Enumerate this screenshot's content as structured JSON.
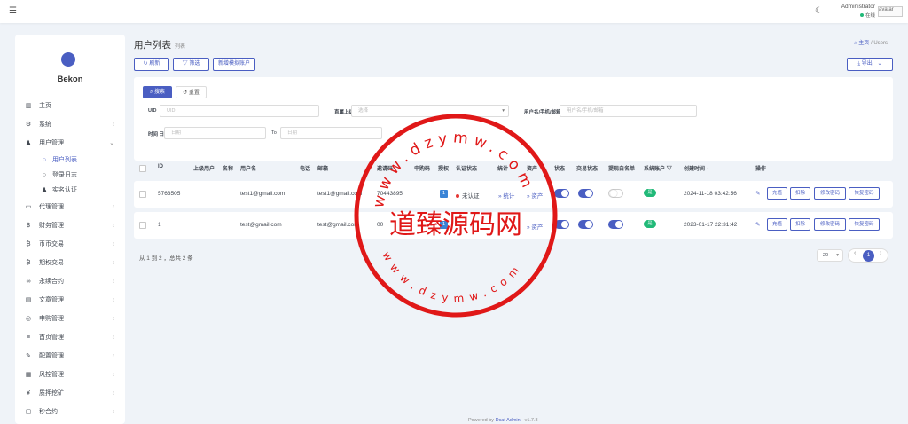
{
  "topbar": {
    "admin_name": "Administrator",
    "status": "在线",
    "avatar_alt": "avatar"
  },
  "sidebar": {
    "logo_text": "Bekon",
    "items": [
      {
        "label": "主页",
        "icon": "chart-icon",
        "chevron": false
      },
      {
        "label": "系统",
        "icon": "gear-icon",
        "chevron": true
      },
      {
        "label": "用户管理",
        "icon": "user-icon",
        "chevron": true,
        "expanded": true
      },
      {
        "label": "用户列表",
        "icon": "circle-icon",
        "sub": true,
        "active": true
      },
      {
        "label": "登录日志",
        "icon": "circle-icon",
        "sub": true
      },
      {
        "label": "实名认证",
        "icon": "user-icon",
        "sub": true
      },
      {
        "label": "代理管理",
        "icon": "id-card-icon",
        "chevron": true
      },
      {
        "label": "财务管理",
        "icon": "dollar-icon",
        "chevron": true
      },
      {
        "label": "币币交易",
        "icon": "bitcoin-icon",
        "chevron": true
      },
      {
        "label": "期权交易",
        "icon": "bitcoin-icon",
        "chevron": true
      },
      {
        "label": "永续合约",
        "icon": "link-icon",
        "chevron": true
      },
      {
        "label": "文章管理",
        "icon": "newspaper-icon",
        "chevron": true
      },
      {
        "label": "申购管理",
        "icon": "target-icon",
        "chevron": true
      },
      {
        "label": "首页管理",
        "icon": "bars-icon",
        "chevron": true
      },
      {
        "label": "配置管理",
        "icon": "wrench-icon",
        "chevron": true
      },
      {
        "label": "风控管理",
        "icon": "grid-icon",
        "chevron": true
      },
      {
        "label": "质押挖矿",
        "icon": "yen-icon",
        "chevron": true
      },
      {
        "label": "秒合约",
        "icon": "square-icon",
        "chevron": true
      }
    ]
  },
  "page": {
    "title": "用户列表",
    "subtitle": "列表",
    "crumb_home": "主页",
    "crumb_current": "Users"
  },
  "toolbar": {
    "refresh": "刷新",
    "filter": "筛选",
    "add": "新增模拟账户",
    "export": "导出"
  },
  "filter": {
    "search": "搜索",
    "reset": "重置",
    "uid_label": "UID",
    "uid_placeholder": "UID",
    "parent_label": "直属上级",
    "parent_placeholder": "选择",
    "account_label": "用户名/手机/邮箱",
    "account_placeholder": "用户名/手机/邮箱",
    "time_label": "时间 日",
    "time_start": "日期",
    "time_to": "To",
    "time_end": "日期"
  },
  "table": {
    "headers": [
      "ID",
      "上级用户",
      "名称",
      "用户名",
      "电话",
      "邮箱",
      "邀请码",
      "申购码",
      "授权",
      "认证状态",
      "统计",
      "资产",
      "状态",
      "交易状态",
      "提现白名单",
      "系统账户",
      "创建时间",
      "操作"
    ],
    "rows": [
      {
        "id": "5763505",
        "username": "test1@gmail.com",
        "email": "test1@gmail.com",
        "invite": "70443895",
        "grant": "1",
        "auth": "未认证",
        "stats": "统计",
        "assets": "资产",
        "system": "是",
        "created": "2024-11-18 03:42:56",
        "actions": [
          "充值",
          "扣除",
          "修改密码",
          "恢复密码"
        ]
      },
      {
        "id": "1",
        "username": "test@gmail.com",
        "email": "test@gmail.com",
        "invite": "00",
        "grant": "1",
        "auth": "",
        "stats": "",
        "assets": "资产",
        "system": "是",
        "created": "2023-01-17 22:31:42",
        "actions": [
          "充值",
          "扣除",
          "修改密码",
          "恢复密码"
        ]
      }
    ]
  },
  "pagination": {
    "summary": "从 1 到 2 ，总共 2 条",
    "per_page": "20",
    "current": "1"
  },
  "footer": {
    "powered": "Powered by",
    "brand": "Dcat Admin",
    "version": "· v1.7.8"
  },
  "watermark": {
    "center": "道臻源码网",
    "arc_top": "www.dzymw.com",
    "arc_bottom": "www.dzymw.com",
    "color": "#e01818"
  },
  "colors": {
    "accent": "#4a5ec2",
    "success": "#21b978",
    "danger": "#e53935"
  }
}
